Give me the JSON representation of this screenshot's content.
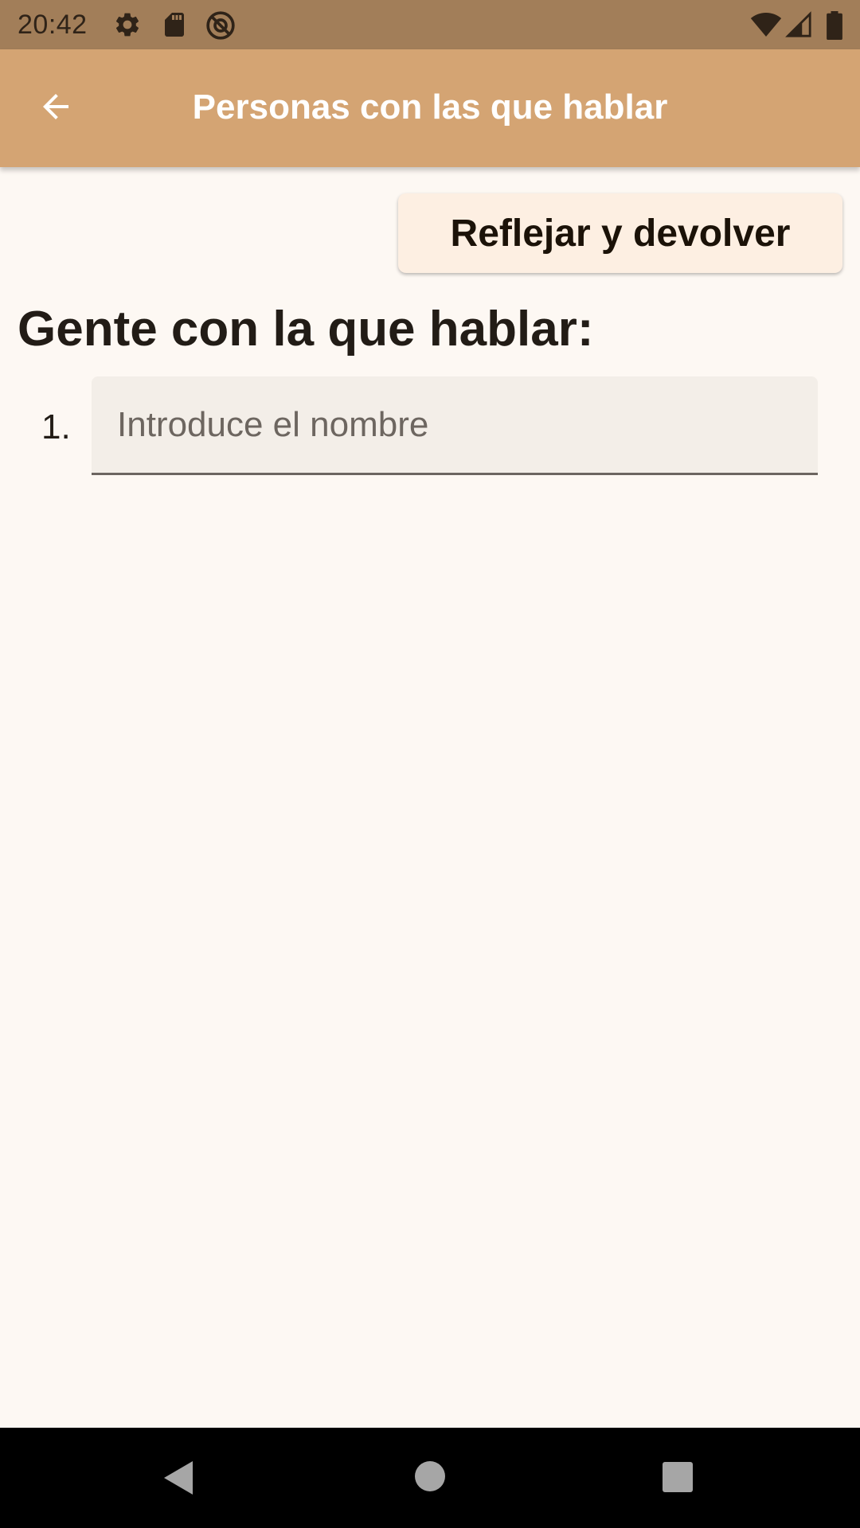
{
  "status_bar": {
    "time": "20:42",
    "icons_left": [
      "gear-icon",
      "sd-card-icon",
      "do-not-disturb-icon"
    ],
    "icons_right": [
      "wifi-icon",
      "signal-icon",
      "battery-icon"
    ],
    "background": "#a27e59"
  },
  "app_bar": {
    "title": "Personas con las que hablar",
    "back_icon": "arrow-back-icon",
    "background": "#d4a473"
  },
  "content": {
    "action_button_label": "Reflejar y devolver",
    "heading": "Gente con la que hablar:",
    "list": [
      {
        "number": "1.",
        "value": "",
        "placeholder": "Introduce el nombre"
      }
    ]
  },
  "nav_bar": {
    "buttons": [
      "back-triangle-icon",
      "home-circle-icon",
      "recents-square-icon"
    ]
  }
}
